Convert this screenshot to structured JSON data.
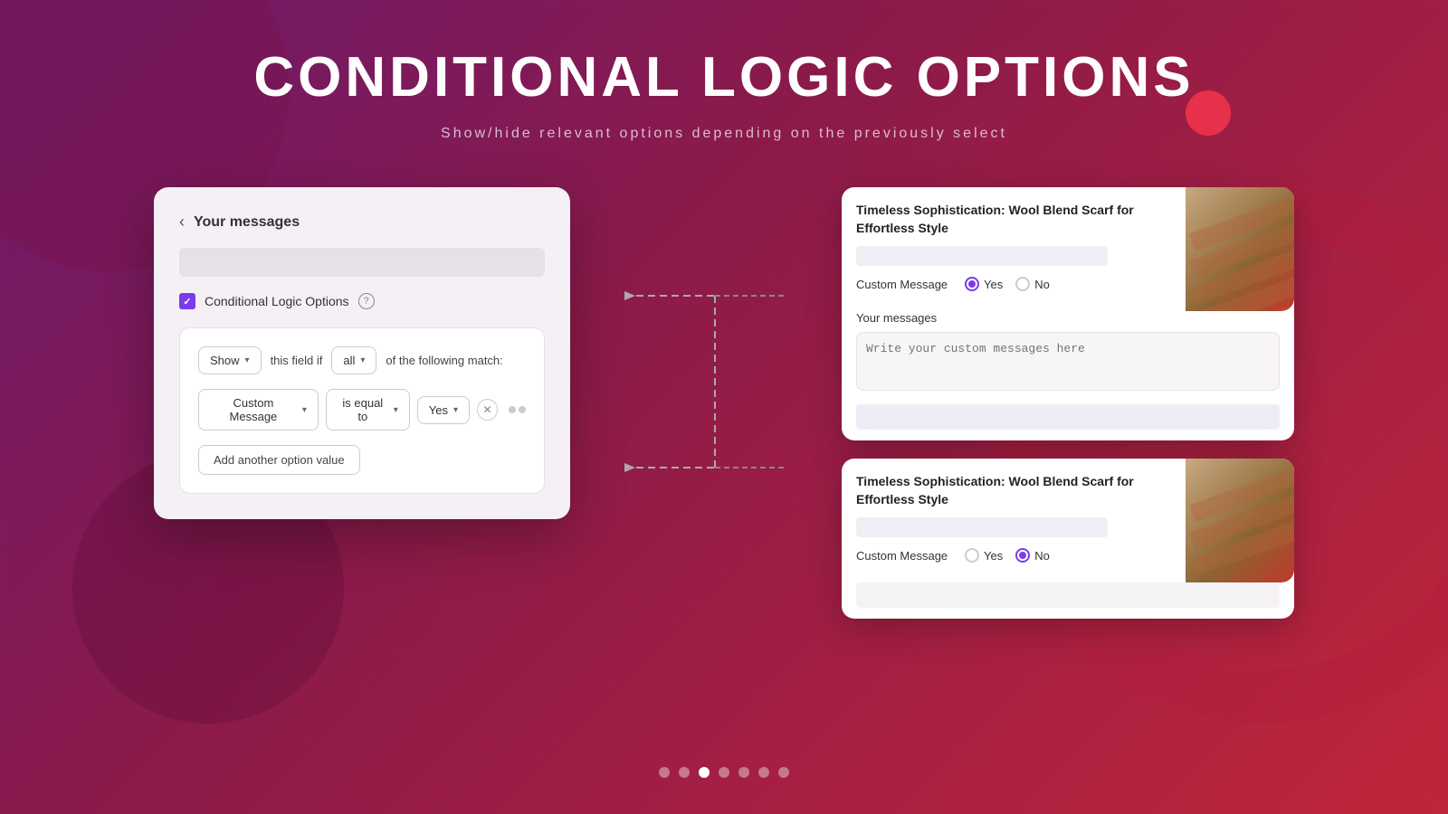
{
  "page": {
    "title": "CONDITIONAL LOGIC OPTIONS",
    "subtitle": "Show/hide relevant options depending on the previously select"
  },
  "left_card": {
    "back_label": "‹",
    "title": "Your messages",
    "checkbox_label": "Conditional Logic Options",
    "show_label": "Show",
    "this_field_if_label": "this field if",
    "all_label": "all",
    "of_the_following_match_label": "of the following match:",
    "custom_message_dropdown": "Custom Message",
    "is_equal_to_dropdown": "is equal to",
    "yes_dropdown": "Yes",
    "add_option_label": "Add another option value"
  },
  "right_top_card": {
    "title": "Timeless Sophistication: Wool Blend Scarf for Effortless Style",
    "custom_message_label": "Custom Message",
    "yes_label": "Yes",
    "no_label": "No",
    "yes_selected": true,
    "your_messages_label": "Your messages",
    "textarea_placeholder": "Write your custom messages here"
  },
  "right_bottom_card": {
    "title": "Timeless Sophistication: Wool Blend Scarf for Effortless Style",
    "custom_message_label": "Custom Message",
    "yes_label": "Yes",
    "no_label": "No",
    "no_selected": true
  },
  "dots": [
    1,
    2,
    3,
    4,
    5,
    6,
    7
  ],
  "active_dot": 3
}
